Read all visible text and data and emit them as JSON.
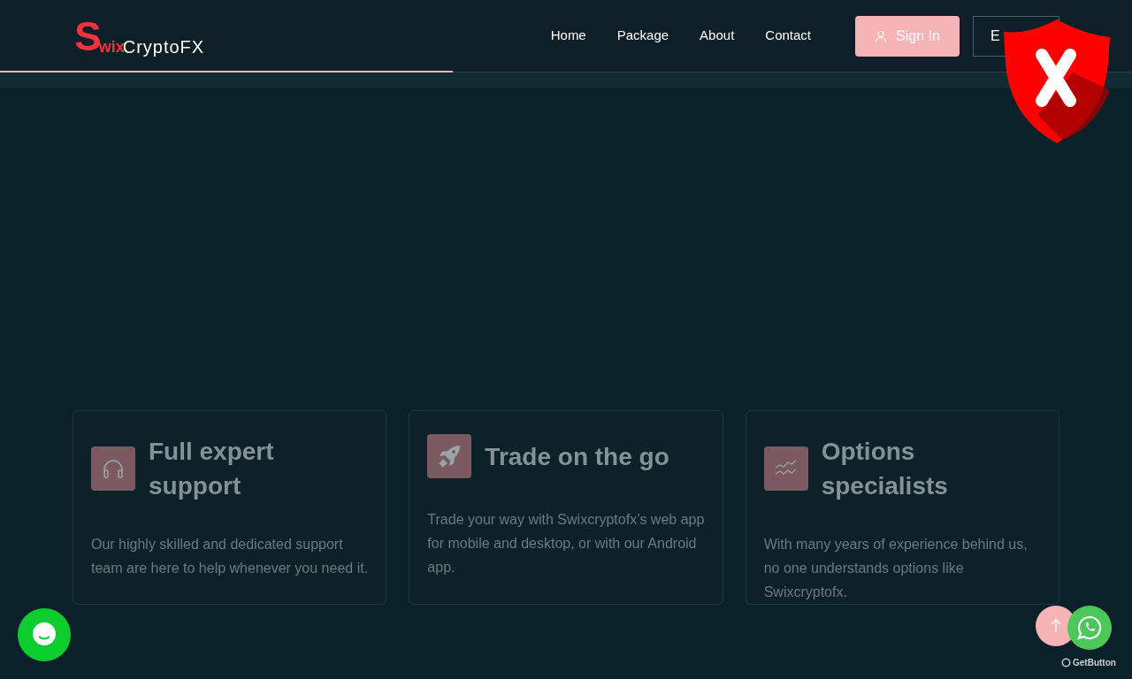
{
  "header": {
    "logo": {
      "mark": "S",
      "mark_rest": "wix",
      "name": "CryptoFX"
    },
    "nav": [
      {
        "label": "Home"
      },
      {
        "label": "Package"
      },
      {
        "label": "About"
      },
      {
        "label": "Contact"
      }
    ],
    "sign_in": "Sign In",
    "language": "E"
  },
  "scroll_progress": {
    "level": 0.4
  },
  "features": [
    {
      "title": "Full expert support",
      "text": "Our highly skilled and dedicated support team are here to help whenever you need it."
    },
    {
      "title": "Trade on the go",
      "text": "Trade your way with Swixcryptofx’s web app for mobile and desktop, or with our Android app."
    },
    {
      "title": "Options specialists",
      "text": "With many years of experience behind us, no one understands options like Swixcryptofx."
    }
  ],
  "widget_brand": "GetButton"
}
